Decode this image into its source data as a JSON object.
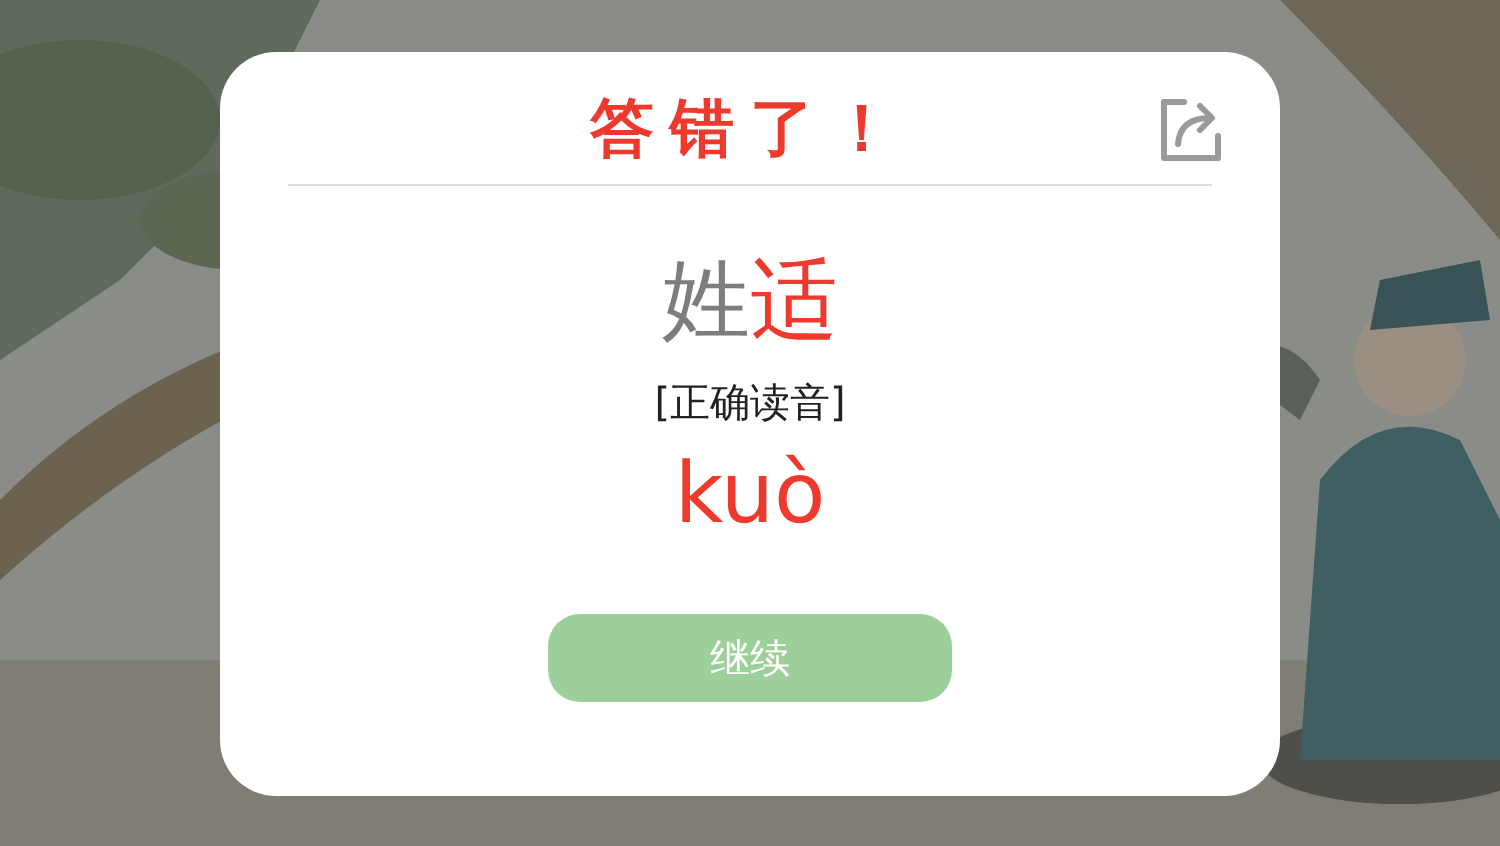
{
  "dialog": {
    "title": "答错了！",
    "word": [
      {
        "char": "姓",
        "highlighted": false
      },
      {
        "char": "适",
        "highlighted": true
      }
    ],
    "label": "[正确读音]",
    "pinyin": "kuò",
    "button": "继续"
  }
}
